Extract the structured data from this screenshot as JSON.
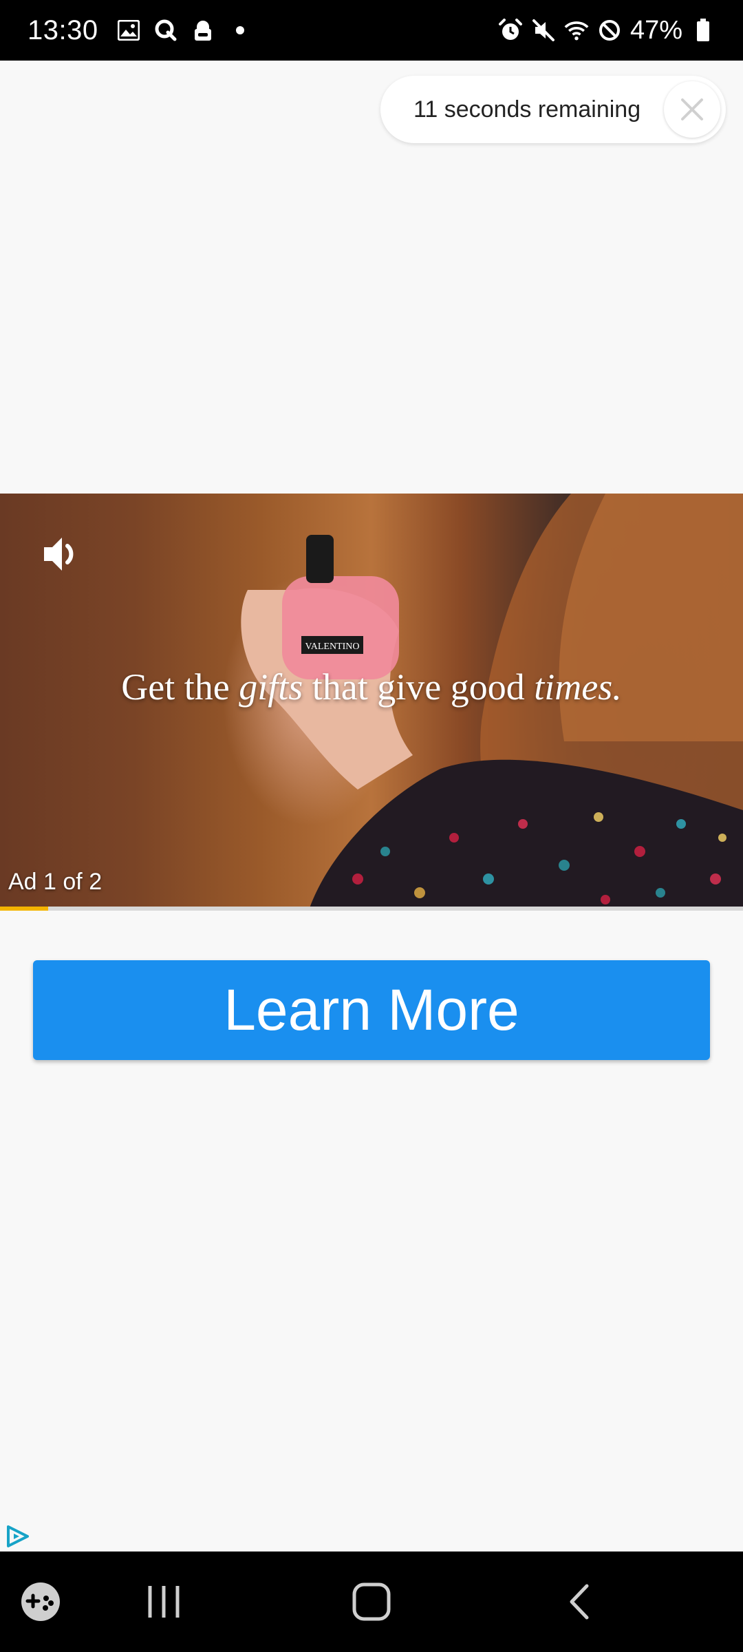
{
  "status_bar": {
    "time": "13:30",
    "left_icons": [
      "gallery-icon",
      "search-q-icon",
      "vpn-lock-icon",
      "notification-dot-icon"
    ],
    "right_icons": [
      "alarm-icon",
      "mute-icon",
      "wifi-icon",
      "do-not-disturb-icon",
      "battery-icon"
    ],
    "battery": "47%"
  },
  "countdown": {
    "text": "11 seconds remaining",
    "close_icon": "close-icon"
  },
  "video": {
    "caption_part1": "Get the ",
    "caption_italic1": "gifts",
    "caption_part2": " that give good ",
    "caption_italic2": "times.",
    "bottle_label": "VALENTINO",
    "ad_counter": "Ad 1 of 2",
    "progress": 0.065,
    "mute_icon": "speaker-icon"
  },
  "cta": {
    "label": "Learn More"
  },
  "adchoices_icon": "adchoices-icon",
  "nav_bar": {
    "icons": [
      "game-launcher-icon",
      "recents-icon",
      "home-icon",
      "back-icon"
    ]
  },
  "colors": {
    "cta_blue": "#1a8fef",
    "progress_yellow": "#f4b400",
    "status_bar": "#000000"
  }
}
